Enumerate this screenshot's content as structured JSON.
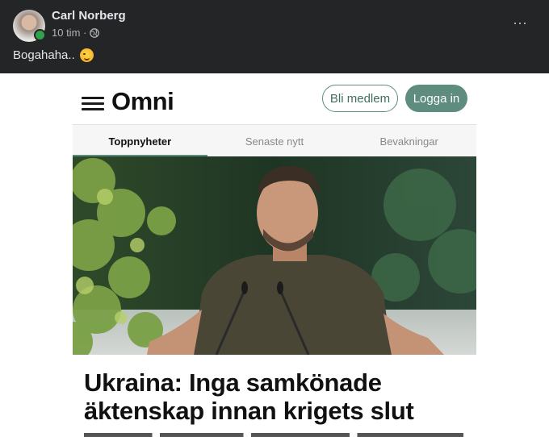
{
  "post": {
    "author": "Carl Norberg",
    "time": "10 tim · ",
    "privacy_icon": "globe-icon",
    "text": "Bogahaha..",
    "emoji": "smirk-emoji",
    "more_icon": "⋯"
  },
  "omni": {
    "logo": "Omni",
    "member_button": "Bli medlem",
    "login_button": "Logga in",
    "tabs": [
      "Toppnyheter",
      "Senaste nytt",
      "Bevakningar"
    ],
    "active_tab": "Toppnyheter",
    "headline_line1": "Ukraina: Inga samkönade",
    "headline_line2": "äktenskap innan krigets slut"
  },
  "colors": {
    "facebook_bg": "#242526",
    "omni_accent": "#5e8c7e",
    "online": "#31a24c"
  }
}
